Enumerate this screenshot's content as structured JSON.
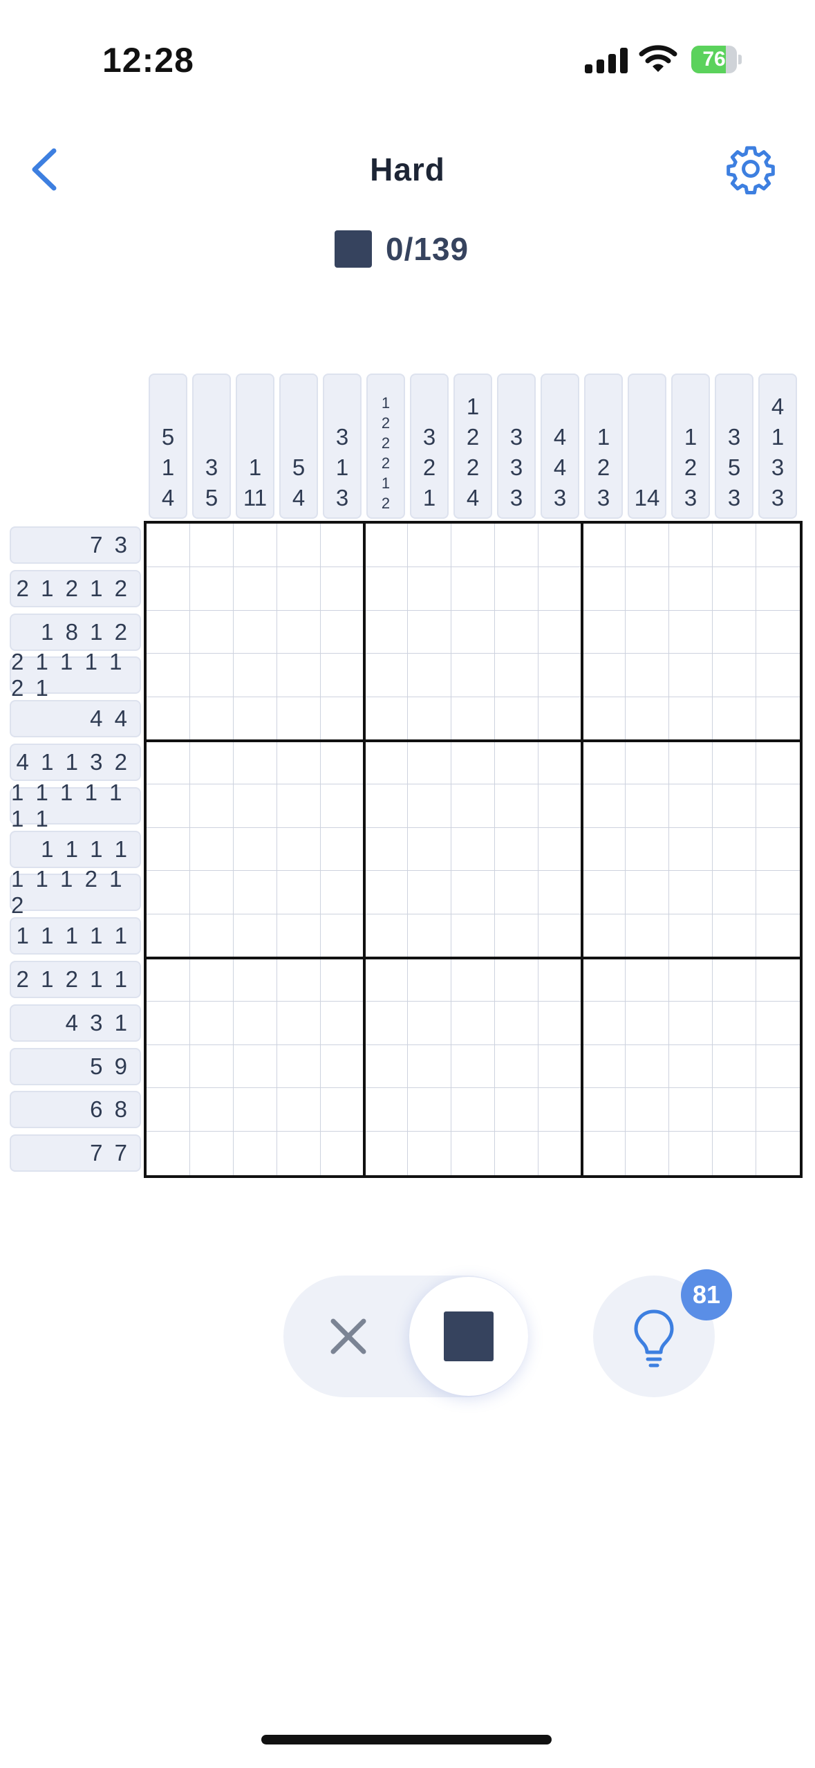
{
  "status_bar": {
    "time": "12:28",
    "battery_level": "76",
    "battery_color": "#5bd25c"
  },
  "header": {
    "title": "Hard",
    "back_icon": "chevron-left-icon",
    "settings_icon": "gear-icon",
    "accent_color": "#3d7fe0"
  },
  "counter": {
    "text": "0/139",
    "swatch_color": "#36435e"
  },
  "puzzle": {
    "size": 15,
    "column_clues": [
      [
        "5",
        "1",
        "4"
      ],
      [
        "3",
        "5"
      ],
      [
        "1",
        "11"
      ],
      [
        "5",
        "4"
      ],
      [
        "3",
        "1",
        "3"
      ],
      [
        "1",
        "2",
        "2",
        "2",
        "1",
        "2"
      ],
      [
        "3",
        "2",
        "1"
      ],
      [
        "1",
        "2",
        "2",
        "4"
      ],
      [
        "3",
        "3",
        "3"
      ],
      [
        "4",
        "4",
        "3"
      ],
      [
        "1",
        "2",
        "3"
      ],
      [
        "14"
      ],
      [
        "1",
        "2",
        "3"
      ],
      [
        "3",
        "5",
        "3"
      ],
      [
        "4",
        "1",
        "3",
        "3"
      ]
    ],
    "row_clues": [
      "7 3",
      "2 1 2 1 2",
      "1 8 1 2",
      "2 1 1 1 1 2 1",
      "4 4",
      "4 1 1 3 2",
      "1 1 1 1 1 1 1",
      "1 1 1 1",
      "1 1 1 2 1 2",
      "1 1 1 1 1",
      "2 1 2 1 1",
      "4 3 1",
      "5 9",
      "6 8",
      "7 7"
    ]
  },
  "controls": {
    "cross_icon": "cross-icon",
    "fill_icon": "filled-square-icon",
    "hint_icon": "lightbulb-icon",
    "hint_count": "81",
    "hint_badge_color": "#5a8ee6"
  }
}
